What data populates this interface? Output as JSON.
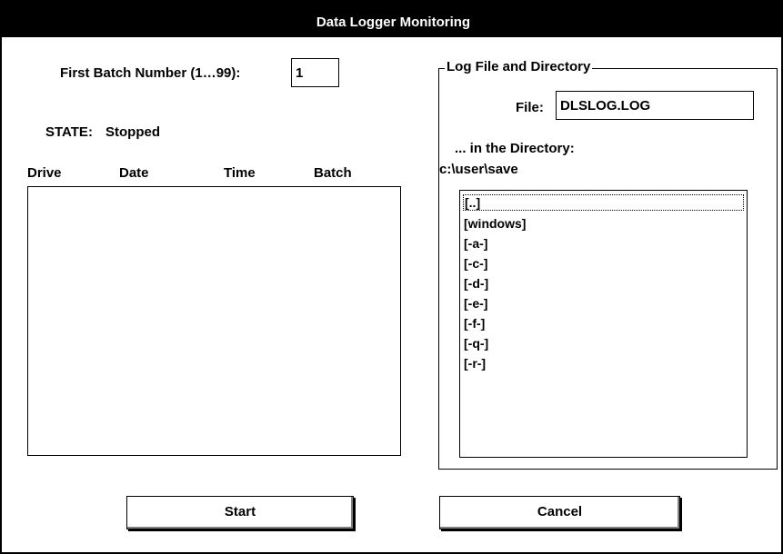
{
  "window": {
    "title": "Data Logger Monitoring"
  },
  "batch": {
    "label": "First Batch Number (1…99):",
    "value": "1"
  },
  "state": {
    "label": "STATE:",
    "value": "Stopped"
  },
  "log_table": {
    "columns": [
      "Drive",
      "Date",
      "Time",
      "Batch"
    ],
    "rows": []
  },
  "log_group": {
    "legend": "Log File and Directory",
    "file_label": "File:",
    "file_value": "DLSLOG.LOG",
    "dir_label": "... in the Directory:",
    "current_dir": "c:\\user\\save",
    "directories": [
      "[..]",
      "[windows]",
      "[-a-]",
      "[-c-]",
      "[-d-]",
      "[-e-]",
      "[-f-]",
      "[-q-]",
      "[-r-]"
    ]
  },
  "buttons": {
    "start": "Start",
    "cancel": "Cancel"
  }
}
